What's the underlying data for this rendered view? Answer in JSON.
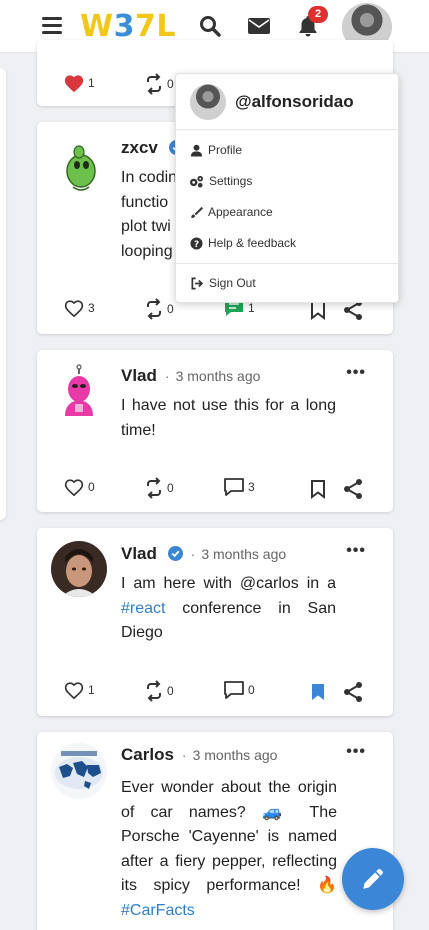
{
  "header": {
    "logo": {
      "part1": "W",
      "part2": "3",
      "part3": "7L"
    },
    "notification_count": "2",
    "colors": {
      "brand_yellow": "#f3c61c",
      "brand_blue": "#3a8fd6",
      "badge_red": "#e02f2f"
    },
    "icons": [
      "menu-icon",
      "search-icon",
      "mail-icon",
      "bell-icon"
    ]
  },
  "user_menu": {
    "username": "@alfonsoridao",
    "items": [
      {
        "label": "Profile",
        "icon": "user-icon"
      },
      {
        "label": "Settings",
        "icon": "gears-icon"
      },
      {
        "label": "Appearance",
        "icon": "brush-icon"
      },
      {
        "label": "Help & feedback",
        "icon": "question-circle-icon"
      }
    ],
    "sign_out": {
      "label": "Sign Out",
      "icon": "sign-out-icon"
    }
  },
  "posts": [
    {
      "likes": "1",
      "reposts": "0"
    },
    {
      "author": "zxcv",
      "verified": true,
      "lines": [
        "In codin",
        "functio",
        "plot twi",
        "looping"
      ],
      "likes": "3",
      "reposts": "0",
      "comments": "1",
      "accent": "#23a455"
    },
    {
      "author": "Vlad",
      "time": "3 months ago",
      "text": "I have not use this for a long time!",
      "likes": "0",
      "reposts": "0",
      "comments": "3"
    },
    {
      "author": "Vlad",
      "verified": true,
      "time": "3 months ago",
      "text_before": "I am here with @carlos in a ",
      "hashtag": "#react",
      "text_after": " conference in San Diego",
      "likes": "1",
      "reposts": "0",
      "comments": "0",
      "bookmark_color": "#3b86d6"
    },
    {
      "author": "Carlos",
      "time": "3 months ago",
      "text_before": "Ever wonder about the origin of car names? 🚙 The Porsche 'Cayenne' is named after a fiery pepper, reflecting its spicy performance! 🔥",
      "hashtag": "#CarFacts"
    }
  ],
  "separator": "·",
  "more_icon": "ellipsis-icon"
}
